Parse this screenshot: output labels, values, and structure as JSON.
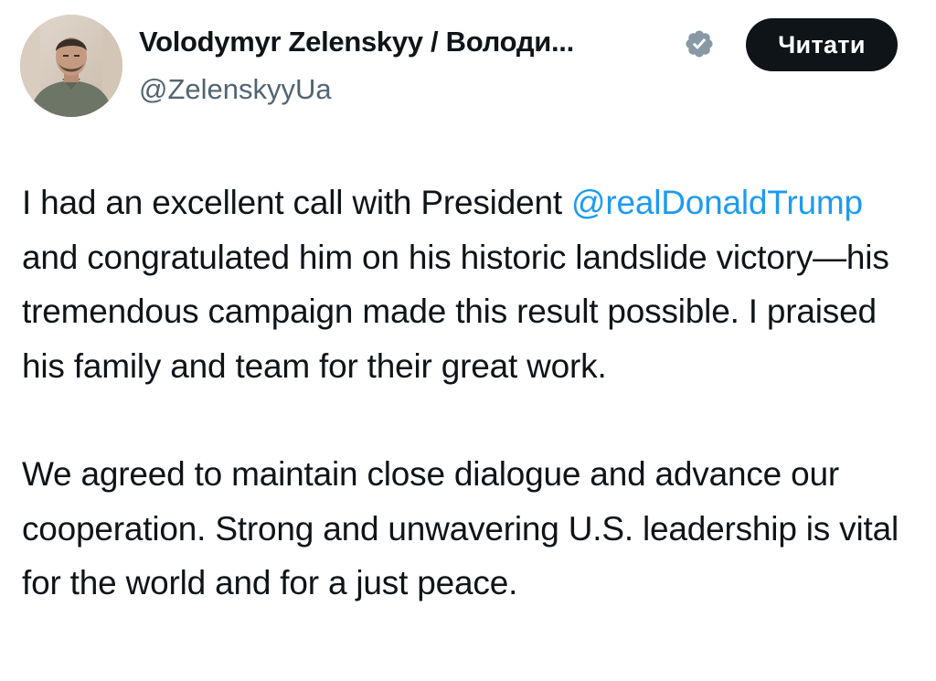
{
  "author": {
    "display_name": "Volodymyr Zelenskyy / Володи...",
    "handle": "@ZelenskyyUa",
    "verified_icon": "verified-badge-icon",
    "verified_color": "#8899a6"
  },
  "actions": {
    "follow_label": "Читати"
  },
  "tweet": {
    "p1_before": "I had an excellent call with President ",
    "p1_mention": "@realDonaldTrump",
    "p1_after": " and congratulated him on his historic landslide victory—his tremendous campaign made this result possible. I praised his family and team for their great work.",
    "p2": "We agreed to maintain close dialogue and advance our cooperation. Strong and unwavering U.S. leadership is vital for the world and for a just peace."
  },
  "colors": {
    "link": "#1d9bf0",
    "button_bg": "#0f1419",
    "secondary_text": "#536471"
  }
}
